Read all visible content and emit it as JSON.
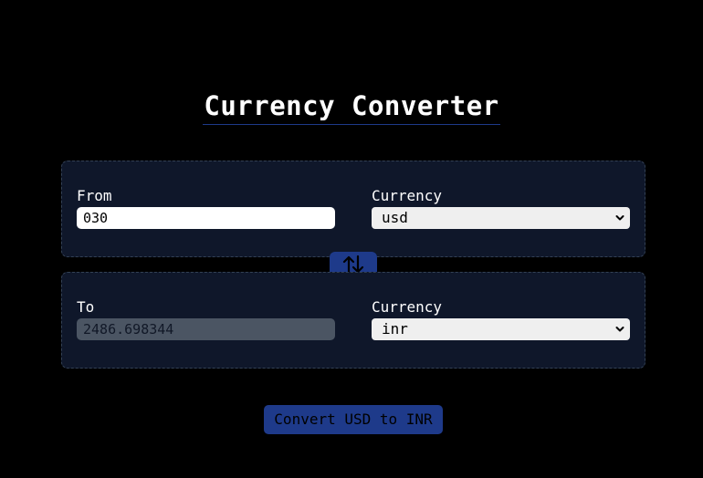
{
  "app": {
    "title": "Currency Converter"
  },
  "from": {
    "label": "From",
    "amount": "030",
    "currency_label": "Currency",
    "currency": "usd"
  },
  "to": {
    "label": "To",
    "amount": "2486.698344",
    "currency_label": "Currency",
    "currency": "inr"
  },
  "swap": {
    "icon": "swap-arrows-icon"
  },
  "convert": {
    "label": "Convert USD to INR"
  },
  "colors": {
    "background": "#000000",
    "card": "#0f172a",
    "accent": "#1e3a8a",
    "card_border": "#334155",
    "disabled_input": "#4b5563"
  }
}
